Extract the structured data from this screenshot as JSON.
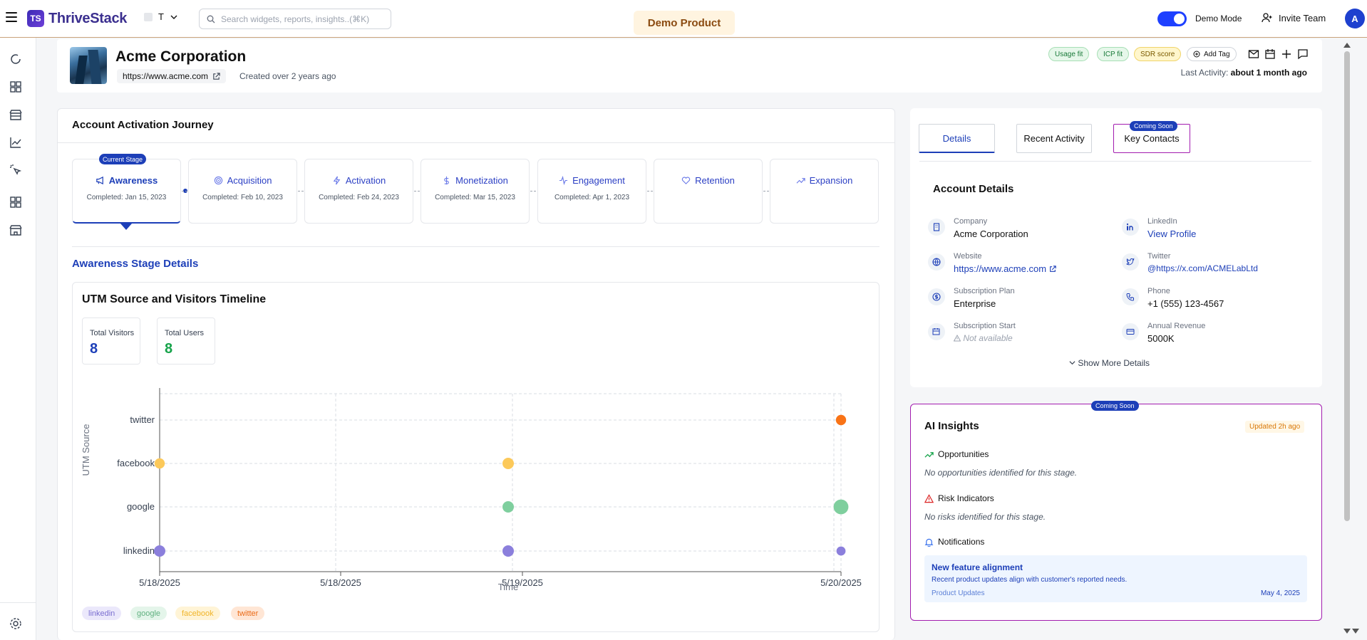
{
  "app": {
    "name": "ThriveStack",
    "logo_initials": "TS",
    "workspace": "T"
  },
  "search": {
    "placeholder": "Search widgets, reports, insights..(⌘K)"
  },
  "topbar": {
    "product_pill": "Demo Product",
    "demo_mode_label": "Demo Mode",
    "demo_mode_on": true,
    "invite_label": "Invite Team",
    "avatar_initial": "A"
  },
  "sidebar": {
    "icons": [
      "refresh-icon",
      "dashboard-grid-icon",
      "store-icon",
      "line-chart-icon",
      "cursor-click-icon",
      "grid-icon",
      "storefront-icon"
    ],
    "settings": "settings-gear-icon"
  },
  "account": {
    "name": "Acme Corporation",
    "url": "https://www.acme.com",
    "created": "Created over 2 years ago",
    "tags": [
      "Usage fit",
      "ICP fit",
      "SDR score"
    ],
    "add_tag": "Add Tag",
    "last_activity_label": "Last Activity:",
    "last_activity_value": "about 1 month ago"
  },
  "journey": {
    "title": "Account Activation Journey",
    "current_badge": "Current Stage",
    "stages": [
      {
        "name": "Awareness",
        "completed": "Completed: Jan 15, 2023",
        "icon": "megaphone-icon"
      },
      {
        "name": "Acquisition",
        "completed": "Completed: Feb 10, 2023",
        "icon": "target-icon"
      },
      {
        "name": "Activation",
        "completed": "Completed: Feb 24, 2023",
        "icon": "lightning-icon"
      },
      {
        "name": "Monetization",
        "completed": "Completed: Mar 15, 2023",
        "icon": "dollar-icon"
      },
      {
        "name": "Engagement",
        "completed": "Completed: Apr 1, 2023",
        "icon": "pulse-icon"
      },
      {
        "name": "Retention",
        "completed": "",
        "icon": "heart-icon"
      },
      {
        "name": "Expansion",
        "completed": "",
        "icon": "trending-up-icon"
      }
    ],
    "stage_details_title": "Awareness Stage Details"
  },
  "utm_card": {
    "title": "UTM Source and Visitors Timeline",
    "kpis": [
      {
        "label": "Total Visitors",
        "value": "8",
        "color": "#1d3fb8"
      },
      {
        "label": "Total Users",
        "value": "8",
        "color": "#16a34a"
      }
    ]
  },
  "chart_data": {
    "type": "scatter",
    "title": "",
    "xlabel": "Time",
    "ylabel": "UTM Source",
    "x_ticks": [
      "5/18/2025",
      "5/18/2025",
      "5/19/2025",
      "5/20/2025"
    ],
    "categories": [
      "twitter",
      "facebook",
      "google",
      "linkedin"
    ],
    "grid": true,
    "legend_position": "bottom-left",
    "series": [
      {
        "name": "linkedin",
        "color": "#8b7fdc",
        "points": [
          {
            "x": "5/18/2025",
            "y": "linkedin",
            "size": 1
          },
          {
            "x": "5/19/2025",
            "y": "linkedin",
            "size": 1
          },
          {
            "x": "5/20/2025",
            "y": "linkedin",
            "size": 0.8
          }
        ]
      },
      {
        "name": "google",
        "color": "#7fcf9e",
        "points": [
          {
            "x": "5/19/2025",
            "y": "google",
            "size": 1
          },
          {
            "x": "5/20/2025",
            "y": "google",
            "size": 1.3
          }
        ]
      },
      {
        "name": "facebook",
        "color": "#fcc95a",
        "points": [
          {
            "x": "5/18/2025",
            "y": "facebook",
            "size": 0.9
          },
          {
            "x": "5/19/2025",
            "y": "facebook",
            "size": 1
          }
        ]
      },
      {
        "name": "twitter",
        "color": "#f97316",
        "points": [
          {
            "x": "5/20/2025",
            "y": "twitter",
            "size": 0.9
          }
        ]
      }
    ]
  },
  "legend": [
    {
      "name": "linkedin",
      "bg": "#ebe8fb",
      "fg": "#7b6fd0"
    },
    {
      "name": "google",
      "bg": "#e4f5ea",
      "fg": "#5fb07f"
    },
    {
      "name": "facebook",
      "bg": "#fff4d6",
      "fg": "#f0b429"
    },
    {
      "name": "twitter",
      "bg": "#ffe6d5",
      "fg": "#ea6a16"
    }
  ],
  "details": {
    "tabs": [
      "Details",
      "Recent Activity",
      "Key Contacts"
    ],
    "coming_soon": "Coming Soon",
    "title": "Account Details",
    "fields": [
      {
        "label": "Company",
        "value": "Acme Corporation",
        "icon": "building-icon"
      },
      {
        "label": "LinkedIn",
        "value": "View Profile",
        "icon": "linkedin-icon"
      },
      {
        "label": "Website",
        "value": "https://www.acme.com",
        "icon": "globe-icon"
      },
      {
        "label": "Twitter",
        "value": "@https://x.com/ACMELabLtd",
        "icon": "twitter-icon"
      },
      {
        "label": "Subscription Plan",
        "value": "Enterprise",
        "icon": "dollar-circle-icon"
      },
      {
        "label": "Phone",
        "value": "+1 (555) 123-4567",
        "icon": "phone-icon"
      },
      {
        "label": "Subscription Start",
        "value": "Not available",
        "icon": "calendar-icon"
      },
      {
        "label": "Annual Revenue",
        "value": "5000K",
        "icon": "credit-card-icon"
      }
    ],
    "show_more": "Show More Details"
  },
  "ai": {
    "coming_soon": "Coming Soon",
    "title": "AI Insights",
    "updated": "Updated 2h ago",
    "opportunities_label": "Opportunities",
    "opportunities_text": "No opportunities identified for this stage.",
    "risk_label": "Risk Indicators",
    "risk_text": "No risks identified for this stage.",
    "notifications_label": "Notifications",
    "notification": {
      "title": "New feature alignment",
      "desc": "Recent product updates align with customer's reported needs.",
      "category": "Product Updates",
      "date": "May 4, 2025"
    }
  }
}
